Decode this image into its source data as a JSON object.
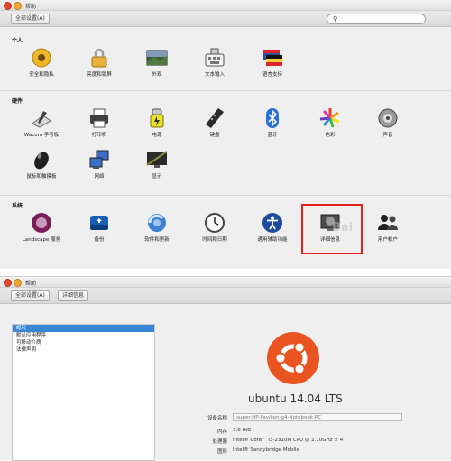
{
  "top_window": {
    "title": "帮助",
    "show_all_button": "全部设置(A)",
    "search": {
      "icon": "search-icon",
      "value": ""
    },
    "sections": [
      {
        "label": "个人",
        "items": [
          {
            "label": "安全和隐私",
            "icon": "security-privacy-icon"
          },
          {
            "label": "亮度和锁屏",
            "icon": "brightness-lock-icon"
          },
          {
            "label": "外观",
            "icon": "appearance-icon"
          },
          {
            "label": "文本输入",
            "icon": "text-entry-icon"
          },
          {
            "label": "语言支持",
            "icon": "language-support-icon"
          }
        ]
      },
      {
        "label": "硬件",
        "items": [
          {
            "label": "Wacom 手写板",
            "icon": "wacom-tablet-icon"
          },
          {
            "label": "打印机",
            "icon": "printer-icon"
          },
          {
            "label": "电源",
            "icon": "power-icon"
          },
          {
            "label": "键盘",
            "icon": "keyboard-icon"
          },
          {
            "label": "蓝牙",
            "icon": "bluetooth-icon"
          },
          {
            "label": "色彩",
            "icon": "color-icon"
          },
          {
            "label": "声音",
            "icon": "sound-icon"
          },
          {
            "label": "鼠标和触摸板",
            "icon": "mouse-touchpad-icon"
          },
          {
            "label": "网络",
            "icon": "network-icon"
          },
          {
            "label": "显示",
            "icon": "display-icon"
          }
        ]
      },
      {
        "label": "系统",
        "items": [
          {
            "label": "Landscape 服务",
            "icon": "landscape-service-icon"
          },
          {
            "label": "备份",
            "icon": "backup-icon"
          },
          {
            "label": "软件和更新",
            "icon": "software-updates-icon"
          },
          {
            "label": "时间和日期",
            "icon": "time-date-icon"
          },
          {
            "label": "通用辅助功能",
            "icon": "accessibility-icon"
          },
          {
            "label": "详细信息",
            "icon": "details-icon"
          },
          {
            "label": "用户帐户",
            "icon": "user-accounts-icon"
          }
        ]
      }
    ],
    "watermark": "Bai"
  },
  "bottom_window": {
    "title": "帮助",
    "show_all_button": "全部设置(A)",
    "breadcrumb_current": "详细信息",
    "sidebar": [
      {
        "label": "概况",
        "selected": true
      },
      {
        "label": "默认应用程序",
        "selected": false
      },
      {
        "label": "可移动介质",
        "selected": false
      },
      {
        "label": "法律声明",
        "selected": false
      }
    ],
    "os_name": "ubuntu 14.04 LTS",
    "device_name_label": "设备名称",
    "device_name_value": "super-HP-Pavilion-g4-Notebook-PC",
    "memory_label": "内存",
    "memory_value": "3.8 GiB",
    "processor_label": "处理器",
    "processor_value": "Intel® Core™ i3-2310M CPU @ 2.10GHz × 4",
    "graphics_label": "图形",
    "graphics_value": "Intel® Sandybridge Mobile"
  },
  "colors": {
    "highlight": "#e3221c",
    "ubuntu_orange": "#e95420",
    "selection": "#3a86d6"
  }
}
